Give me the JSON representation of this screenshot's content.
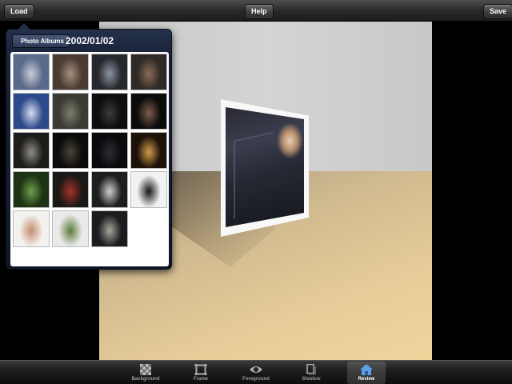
{
  "toolbar": {
    "load_label": "Load",
    "help_label": "Help",
    "save_label": "Save"
  },
  "popover": {
    "back_label": "Photo Albums",
    "title": "2002/01/02",
    "thumbnails": [
      {
        "name": "photo-1",
        "colors": [
          "#5a6a8a",
          "#c9ccd6"
        ]
      },
      {
        "name": "photo-2",
        "colors": [
          "#4a3b33",
          "#a98e7d"
        ]
      },
      {
        "name": "photo-3",
        "colors": [
          "#26282d",
          "#8c95a3"
        ]
      },
      {
        "name": "photo-4",
        "colors": [
          "#2e2a27",
          "#8a6c56"
        ]
      },
      {
        "name": "photo-5",
        "colors": [
          "#2c4a8a",
          "#d6dcef"
        ]
      },
      {
        "name": "photo-6",
        "colors": [
          "#3b3b35",
          "#7b7e6c"
        ]
      },
      {
        "name": "photo-7",
        "colors": [
          "#0c0d0e",
          "#3b3d3c"
        ]
      },
      {
        "name": "photo-8",
        "colors": [
          "#0b0b0c",
          "#7d5c4a"
        ]
      },
      {
        "name": "photo-9",
        "colors": [
          "#1d1c1a",
          "#8f8c87"
        ]
      },
      {
        "name": "photo-10",
        "colors": [
          "#0c0b0b",
          "#4a4338"
        ]
      },
      {
        "name": "photo-11",
        "colors": [
          "#0a0a0c",
          "#2c2d33"
        ]
      },
      {
        "name": "photo-12",
        "colors": [
          "#1c120a",
          "#d49c4a"
        ]
      },
      {
        "name": "photo-13",
        "colors": [
          "#1e3214",
          "#6aa04c"
        ]
      },
      {
        "name": "photo-14",
        "colors": [
          "#1b1916",
          "#a8302a"
        ]
      },
      {
        "name": "photo-15",
        "colors": [
          "#1d1d1e",
          "#cfd0d4"
        ]
      },
      {
        "name": "photo-16",
        "colors": [
          "#f2f2f2",
          "#141414"
        ]
      },
      {
        "name": "photo-17",
        "colors": [
          "#f4f2ef",
          "#c48c6c"
        ]
      },
      {
        "name": "photo-18",
        "colors": [
          "#eaeaea",
          "#5a7a3c"
        ]
      },
      {
        "name": "photo-19",
        "colors": [
          "#1c1c1e",
          "#a8a49c"
        ]
      }
    ]
  },
  "tabs": [
    {
      "key": "background",
      "label": "Background",
      "icon": "checker-icon"
    },
    {
      "key": "frame",
      "label": "Frame",
      "icon": "frame-icon"
    },
    {
      "key": "foreground",
      "label": "Foreground",
      "icon": "eye-icon"
    },
    {
      "key": "shadow",
      "label": "Shadow",
      "icon": "shadow-icon"
    },
    {
      "key": "review",
      "label": "Review",
      "icon": "house-icon",
      "active": true
    }
  ],
  "colors": {
    "accent_active_tab": "#5aa0e6",
    "popover_bg": "#182238"
  }
}
